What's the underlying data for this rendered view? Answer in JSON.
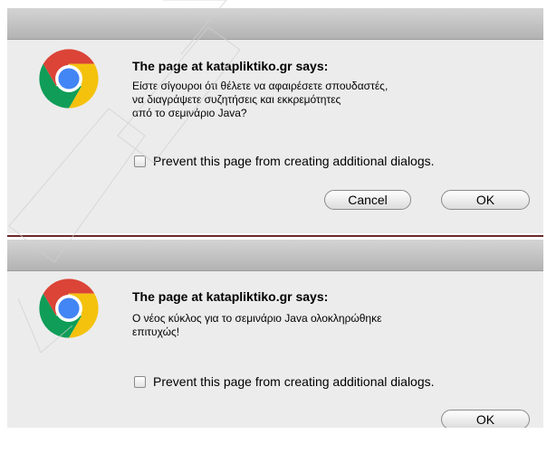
{
  "dialogs": [
    {
      "title": "The page at katapliktiko.gr says:",
      "message": "Είστε σίγουροι ότι θέλετε να αφαιρέσετε σπουδαστές,\nνα διαγράψετε συζητήσεις και εκκρεμότητες\nαπό το σεμινάριο Java?",
      "checkbox_label": "Prevent this page from creating additional dialogs.",
      "checkbox_checked": false,
      "buttons": [
        "Cancel",
        "OK"
      ],
      "icon": "chrome-icon"
    },
    {
      "title": "The page at katapliktiko.gr says:",
      "message": "Ο νέος κύκλος για το σεμινάριο Java ολοκληρώθηκε\nεπιτυχώς!",
      "checkbox_label": "Prevent this page from creating additional dialogs.",
      "checkbox_checked": false,
      "buttons": [
        "OK"
      ],
      "icon": "chrome-icon"
    }
  ],
  "colors": {
    "dialog_background": "#ececec",
    "titlebar_top": "#d4d4d4",
    "titlebar_bottom": "#b3b3b3",
    "divider": "#6b2a2a",
    "chrome_red": "#db4437",
    "chrome_yellow": "#f4c20d",
    "chrome_green": "#0f9d58",
    "chrome_blue": "#4285f4"
  }
}
